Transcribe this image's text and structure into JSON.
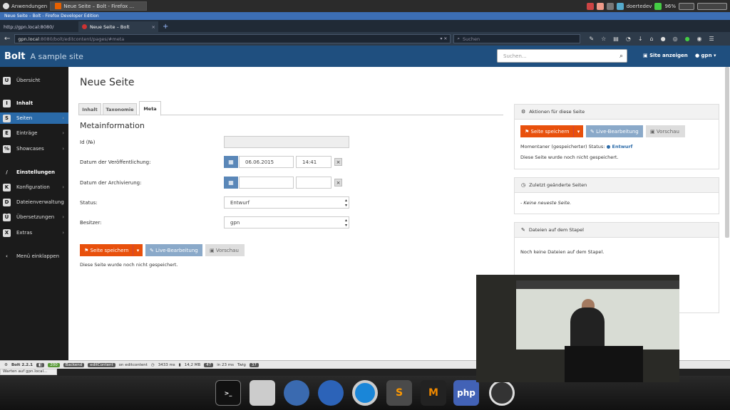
{
  "os": {
    "apps_label": "Anwendungen",
    "window_button": "Neue Seite – Bolt - Firefox ...",
    "tray_user": "doertedev",
    "battery": "96%"
  },
  "browser": {
    "window_title": "Neue Seite – Bolt - Firefox Developer Edition",
    "tabs": [
      {
        "label": "http://gpn.local:8080/"
      },
      {
        "label": "Neue Seite – Bolt"
      }
    ],
    "url_host": "gpn.local",
    "url_path": ":8080/bolt/editcontent/pages/#meta",
    "search_placeholder": "Suchen"
  },
  "header": {
    "brand": "Bolt",
    "site_name": "A sample site",
    "search_placeholder": "Suchen...",
    "show_site": "Site anzeigen",
    "user": "gpn"
  },
  "sidebar": {
    "items": [
      {
        "label": "Übersicht",
        "icon": "U"
      },
      {
        "label": "Inhalt",
        "icon": "I"
      },
      {
        "label": "Seiten",
        "icon": "S"
      },
      {
        "label": "Einträge",
        "icon": "E"
      },
      {
        "label": "Showcases",
        "icon": "%"
      },
      {
        "label": "Einstellungen",
        "icon": "/"
      },
      {
        "label": "Konfiguration",
        "icon": "K"
      },
      {
        "label": "Dateienverwaltung",
        "icon": "D"
      },
      {
        "label": "Übersetzungen",
        "icon": "Ü"
      },
      {
        "label": "Extras",
        "icon": "X"
      },
      {
        "label": "Menü einklappen",
        "icon": "‹"
      }
    ]
  },
  "main": {
    "title": "Neue Seite",
    "tabs": [
      {
        "label": "Inhalt"
      },
      {
        "label": "Taxonomie"
      },
      {
        "label": "Meta"
      }
    ],
    "section_title": "Metainformation",
    "fields": {
      "id_label": "Id (№)",
      "id_value": "",
      "publish_label": "Datum der Veröffentlichung:",
      "publish_date": "06.06.2015",
      "publish_time": "14:41",
      "archive_label": "Datum der Archivierung:",
      "archive_date": "",
      "archive_time": "",
      "status_label": "Status:",
      "status_value": "Entwurf",
      "owner_label": "Besitzer:",
      "owner_value": "gpn"
    },
    "save_button": "Seite speichern",
    "live_button": "Live-Bearbeitung",
    "preview_button": "Vorschau",
    "not_saved_note": "Diese Seite wurde noch nicht gespeichert."
  },
  "panels": {
    "actions": {
      "title": "Aktionen für diese Seite",
      "save_button": "Seite speichern",
      "live_button": "Live-Bearbeitung",
      "preview_button": "Vorschau",
      "status_prefix": "Momentaner (gespeicherter) Status:",
      "status_value": "Entwurf",
      "note": "Diese Seite wurde noch nicht gespeichert."
    },
    "recent": {
      "title": "Zuletzt geänderte Seiten",
      "empty": "- Keine neueste Seite."
    },
    "stack": {
      "title": "Dateien auf dem Stapel",
      "empty": "Noch keine Dateien auf dem Stapel."
    }
  },
  "debugbar": {
    "version": "Bolt 2.2.1",
    "status_code": "200",
    "backend": "Backend",
    "route": "editContent",
    "route_suffix": "on editcontent",
    "time": "3433 ms",
    "memory": "14,2 MB",
    "queries": "47",
    "query_time": "in 23 ms",
    "twig": "Twig",
    "twig_count": "37"
  },
  "statusbar": {
    "loading": "Warten auf gpn.local..."
  },
  "dock": {
    "items": [
      {
        "name": "terminal-icon"
      },
      {
        "name": "files-icon"
      },
      {
        "name": "mail-icon"
      },
      {
        "name": "firefox-icon"
      },
      {
        "name": "chromium-icon"
      },
      {
        "name": "sublime-icon",
        "label": "S"
      },
      {
        "name": "mr-icon",
        "label": "M"
      },
      {
        "name": "phpstorm-icon",
        "label": "php"
      },
      {
        "name": "podcast-icon"
      }
    ]
  },
  "colors": {
    "bolt_header": "#1f4f7f",
    "sidebar_active": "#2a6aa8",
    "save_orange": "#e8500c",
    "live_blue": "#8aa9c9"
  }
}
